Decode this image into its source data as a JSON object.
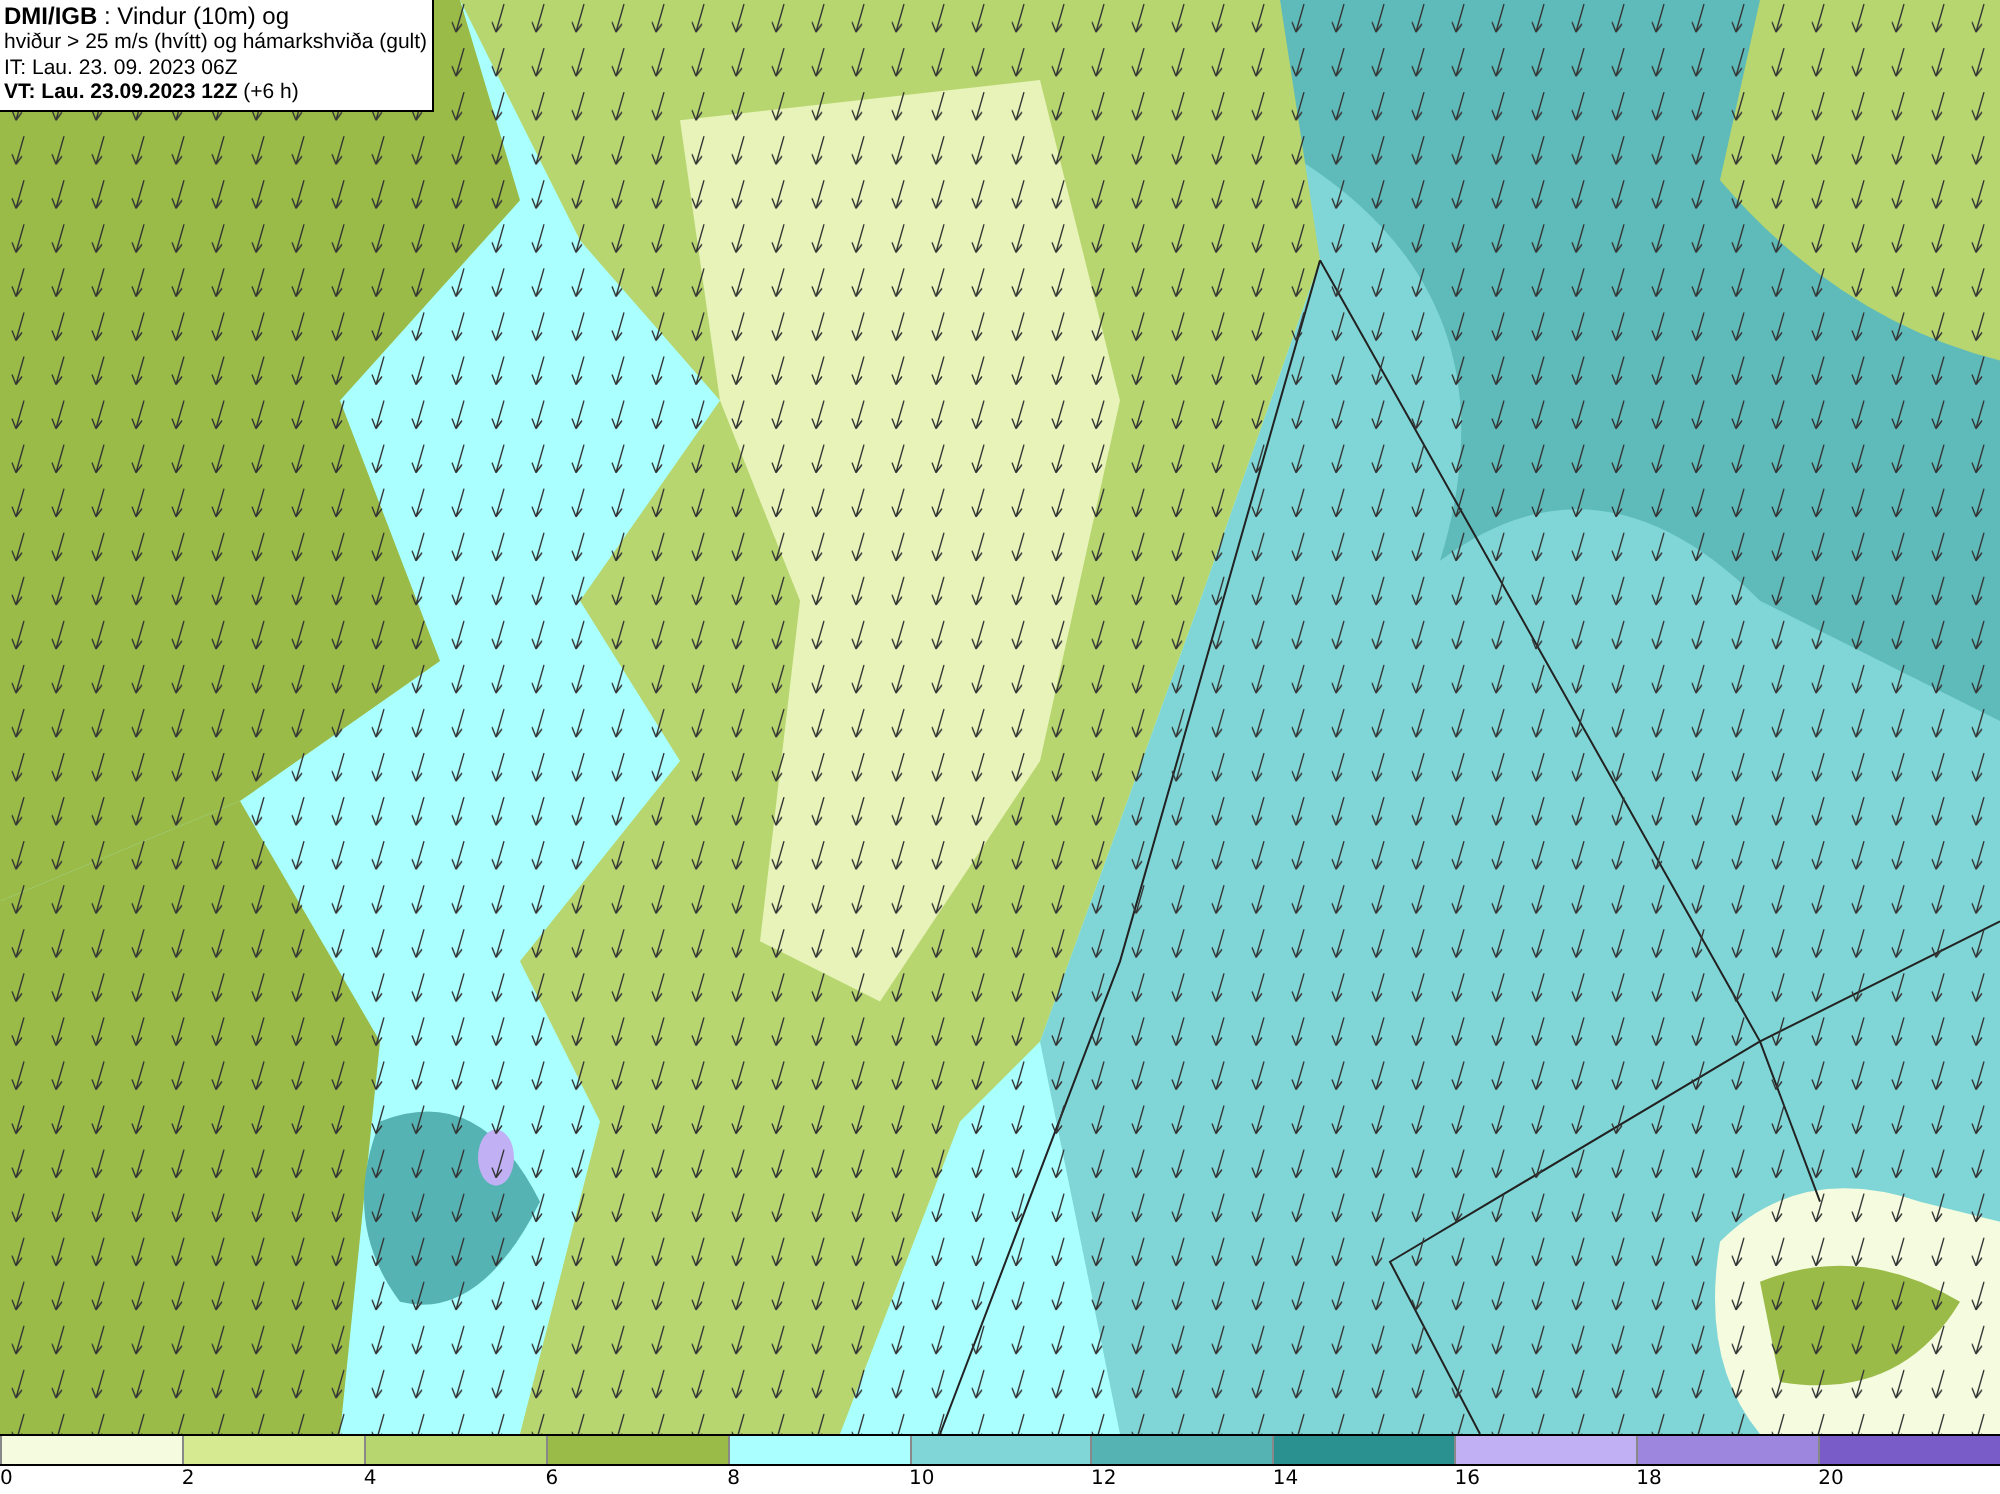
{
  "title_box": {
    "lines": [
      "**DMI/IGB** : Vindur (10m) og",
      "hviður > 25 m/s (hvítt) og hámarkshviða (gult)",
      "IT: Lau. 23. 09. 2023 06Z",
      "**VT: Lau. 23.09.2023 12Z** (+6 h)"
    ]
  },
  "legend": {
    "bins": [
      {
        "color": "#f5fbdf",
        "label": "0"
      },
      {
        "color": "#d6ea92",
        "label": "2"
      },
      {
        "color": "#b7d66f",
        "label": "4"
      },
      {
        "color": "#9abb47",
        "label": "6"
      },
      {
        "color": "#aaffff",
        "label": "8"
      },
      {
        "color": "#80d6d6",
        "label": "10"
      },
      {
        "color": "#56b3b3",
        "label": "12"
      },
      {
        "color": "#2b9090",
        "label": "14"
      },
      {
        "color": "#c1b0f4",
        "label": "16"
      },
      {
        "color": "#9d86de",
        "label": "18"
      },
      {
        "color": "#7a5cc8",
        "label": "20"
      }
    ]
  }
}
